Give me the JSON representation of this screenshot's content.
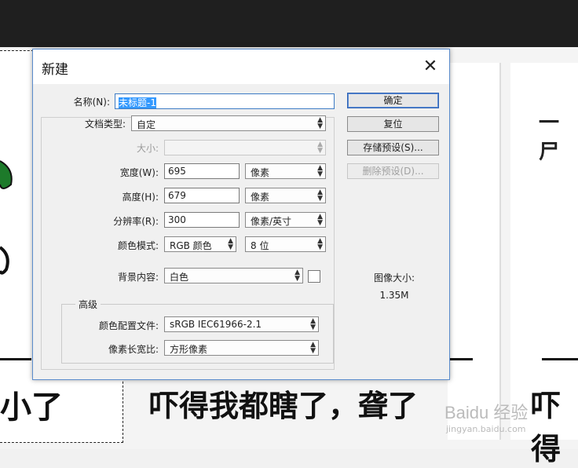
{
  "background": {
    "text_left": "小了",
    "text_middle": "吓得我都瞎了，聋了",
    "text_right": "吓得",
    "text_top_right": "一尸",
    "watermark": "Baidu 经验",
    "watermark_url": "jingyan.baidu.com"
  },
  "dialog": {
    "title": "新建",
    "close_glyph": "✕",
    "name_label": "名称(N):",
    "name_value": "未标题-1",
    "preset_label": "文档类型:",
    "preset_value": "自定",
    "size_label": "大小:",
    "size_value": "",
    "width_label": "宽度(W):",
    "width_value": "695",
    "width_unit": "像素",
    "height_label": "高度(H):",
    "height_value": "679",
    "height_unit": "像素",
    "resolution_label": "分辨率(R):",
    "resolution_value": "300",
    "resolution_unit": "像素/英寸",
    "color_mode_label": "颜色模式:",
    "color_mode_value": "RGB 颜色",
    "bit_depth_value": "8 位",
    "background_label": "背景内容:",
    "background_value": "白色",
    "advanced_label": "高级",
    "color_profile_label": "颜色配置文件:",
    "color_profile_value": "sRGB IEC61966-2.1",
    "pixel_aspect_label": "像素长宽比:",
    "pixel_aspect_value": "方形像素",
    "buttons": {
      "ok": "确定",
      "reset": "复位",
      "save_preset": "存储预设(S)...",
      "delete_preset": "删除预设(D)..."
    },
    "image_size_label": "图像大小:",
    "image_size_value": "1.35M"
  },
  "colors": {
    "accent": "#3399ff",
    "titlebar": "#ffffff",
    "dialog_bg": "#f0f0f0"
  }
}
